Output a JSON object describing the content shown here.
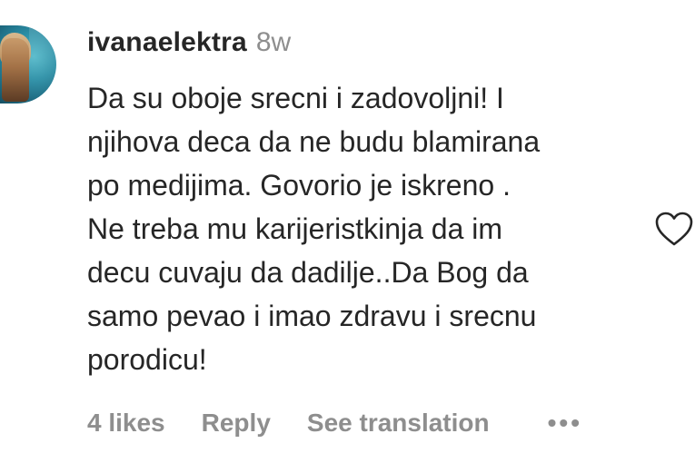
{
  "comment": {
    "username": "ivanaelektra",
    "timestamp": "8w",
    "lines": [
      "Da su oboje srecni i zadovoljni! I",
      "njihova deca da ne budu blamirana",
      "po medijima. Govorio je iskreno .",
      "Ne treba mu karijeristkinja da im",
      "decu cuvaju da dadilje..Da Bog da",
      "samo pevao i imao zdravu i srecnu",
      "porodicu!"
    ],
    "likes": "4 likes",
    "reply": "Reply",
    "see_translation": "See translation",
    "more": "•••"
  },
  "icons": {
    "like": "heart-outline-icon",
    "avatar": "user-avatar"
  },
  "colors": {
    "primary_text": "#262626",
    "secondary_text": "#8e8e8e",
    "background": "#ffffff"
  }
}
